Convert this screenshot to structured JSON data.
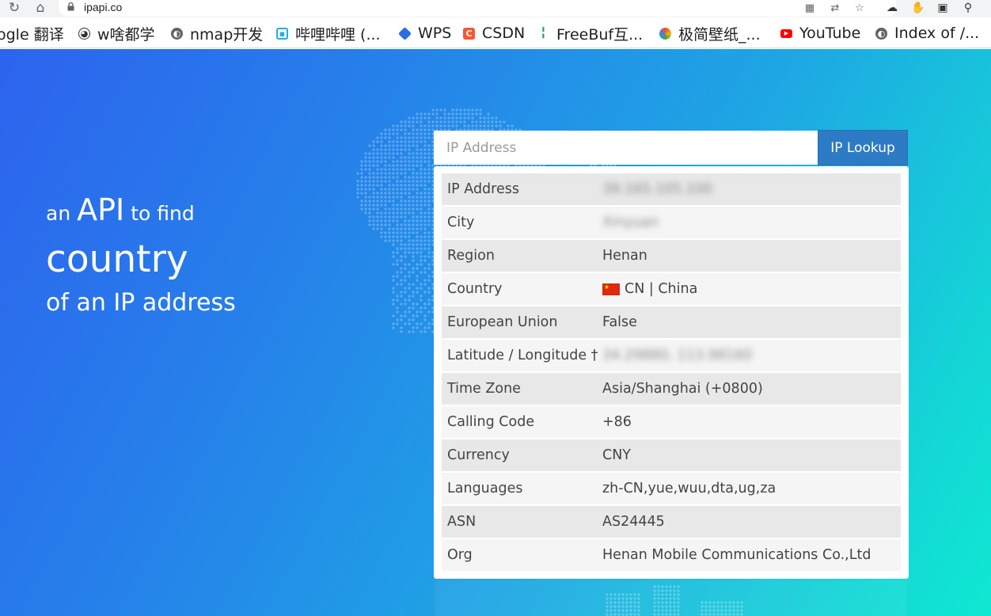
{
  "browser": {
    "url": "ipapi.co",
    "bookmarks": [
      {
        "label": "ogle 翻译",
        "color": "#4285f4"
      },
      {
        "label": "w啥都学",
        "color": "#333333"
      },
      {
        "label": "nmap开发",
        "color": "#555555"
      },
      {
        "label": "哔哩哔哩 (...",
        "color": "#23ade5"
      },
      {
        "label": "WPS",
        "color": "#2b6de0"
      },
      {
        "label": "CSDN",
        "color": "#fc5531"
      },
      {
        "label": "FreeBuf互...",
        "color": "#2e9e5b"
      },
      {
        "label": "极简壁纸_...",
        "color": "#e94e3c"
      },
      {
        "label": "YouTube",
        "color": "#ff0000"
      },
      {
        "label": "Index of /...",
        "color": "#555555"
      }
    ]
  },
  "hero": {
    "pre": "an",
    "api": "API",
    "post": "to find",
    "country": "country",
    "line3": "of an IP address"
  },
  "search": {
    "placeholder": "IP Address",
    "button": "IP Lookup"
  },
  "results": [
    {
      "label": "IP Address",
      "value": "39.165.105.100",
      "blurred": true
    },
    {
      "label": "City",
      "value": "Xinyuan",
      "blurred": true
    },
    {
      "label": "Region",
      "value": "Henan"
    },
    {
      "label": "Country",
      "value": "CN | China",
      "flag": true
    },
    {
      "label": "European Union",
      "value": "False"
    },
    {
      "label": "Latitude / Longitude †",
      "value": "34.29880, 113.98160",
      "blurred": true
    },
    {
      "label": "Time Zone",
      "value": "Asia/Shanghai (+0800)"
    },
    {
      "label": "Calling Code",
      "value": "+86"
    },
    {
      "label": "Currency",
      "value": "CNY"
    },
    {
      "label": "Languages",
      "value": "zh-CN,yue,wuu,dta,ug,za"
    },
    {
      "label": "ASN",
      "value": "AS24445"
    },
    {
      "label": "Org",
      "value": "Henan Mobile Communications Co.,Ltd"
    }
  ],
  "colors": {
    "button": "#2d7bc4",
    "flag_red": "#de2910",
    "flag_star": "#ffde00"
  }
}
